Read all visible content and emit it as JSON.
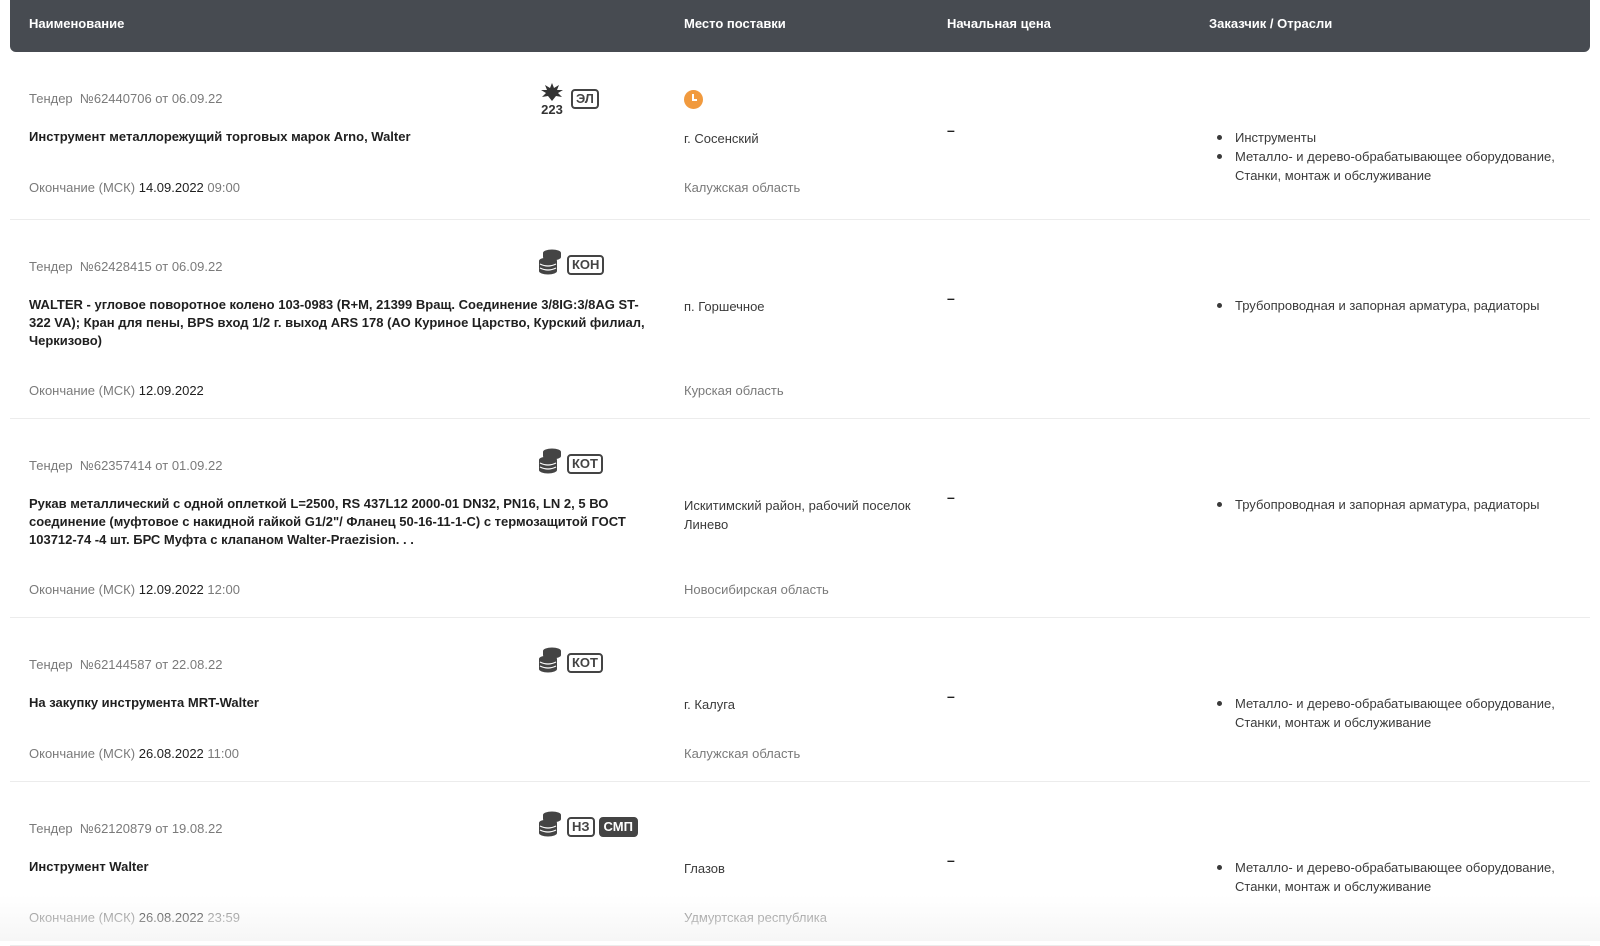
{
  "header": {
    "name": "Наименование",
    "place": "Место поставки",
    "price": "Начальная цена",
    "customer": "Заказчик / Отрасли"
  },
  "tenders": [
    {
      "label": "Тендер",
      "number": "№62440706 от 06.09.22",
      "badges": [
        "ЭЛ"
      ],
      "icon": "law-223-icon",
      "icon_text": "223",
      "has_clock": true,
      "title": "Инструмент металлорежущий торговых марок Arno, Walter",
      "deadline_label": "Окончание (МСК)",
      "deadline_date": "14.09.2022",
      "deadline_time": "09:00",
      "place": "г. Сосенский",
      "region": "Калужская область",
      "price": "–",
      "industries": [
        "Инструменты",
        "Металло- и дерево-обрабатывающее оборудование, Станки, монтаж и обслуживание"
      ]
    },
    {
      "label": "Тендер",
      "number": "№62428415 от 06.09.22",
      "badges": [
        "КОН"
      ],
      "icon": "coins-icon",
      "has_clock": false,
      "title": "WALTER - угловое поворотное колено 103-0983 (R+M, 21399 Вращ. Соединение 3/8IG:3/8AG ST-322 VA); Кран для пены, BPS вход 1/2 г. выход ARS 178 (АО Куриное Царство, Курский филиал, Черкизово)",
      "deadline_label": "Окончание (МСК)",
      "deadline_date": "12.09.2022",
      "deadline_time": "",
      "place": "п. Горшечное",
      "region": "Курская область",
      "price": "–",
      "industries": [
        "Трубопроводная и запорная арматура, радиаторы"
      ]
    },
    {
      "label": "Тендер",
      "number": "№62357414 от 01.09.22",
      "badges": [
        "КОТ"
      ],
      "icon": "coins-icon",
      "has_clock": false,
      "title": "Рукав металлический с одной оплеткой L=2500, RS 437L12 2000-01 DN32, PN16, LN 2, 5 ВО соединение (муфтовое с накидной гайкой G1/2\"/ Фланец 50-16-11-1-С) с термозащитой ГОСТ 103712-74 -4 шт. БРС Муфта с клапаном Walter-Praezision. . .",
      "deadline_label": "Окончание (МСК)",
      "deadline_date": "12.09.2022",
      "deadline_time": "12:00",
      "place": "Искитимский район, рабочий по­селок Линево",
      "region": "Новосибирская область",
      "price": "–",
      "industries": [
        "Трубопроводная и запорная арматура, радиаторы"
      ]
    },
    {
      "label": "Тендер",
      "number": "№62144587 от 22.08.22",
      "badges": [
        "КОТ"
      ],
      "icon": "coins-icon",
      "has_clock": false,
      "title": "На закупку инструмента MRT-Walter",
      "deadline_label": "Окончание (МСК)",
      "deadline_date": "26.08.2022",
      "deadline_time": "11:00",
      "place": "г. Калуга",
      "region": "Калужская область",
      "price": "–",
      "industries": [
        "Металло- и дерево-обрабатывающее оборудование, Станки, монтаж и обслуживание"
      ]
    },
    {
      "label": "Тендер",
      "number": "№62120879 от 19.08.22",
      "badges": [
        "НЗ",
        "СМП"
      ],
      "icon": "coins-icon",
      "has_clock": false,
      "title": "Инструмент Walter",
      "deadline_label": "Окончание (МСК)",
      "deadline_date": "26.08.2022",
      "deadline_time": "23:59",
      "place": "Глазов",
      "region": "Удмуртская республика",
      "price": "–",
      "industries": [
        "Металло- и дерево-обрабатывающее оборудование, Станки, монтаж и обслуживание"
      ]
    }
  ],
  "colors": {
    "header_bg": "#474b51",
    "clock": "#f19a3e",
    "muted_text": "#7a7a7a"
  }
}
